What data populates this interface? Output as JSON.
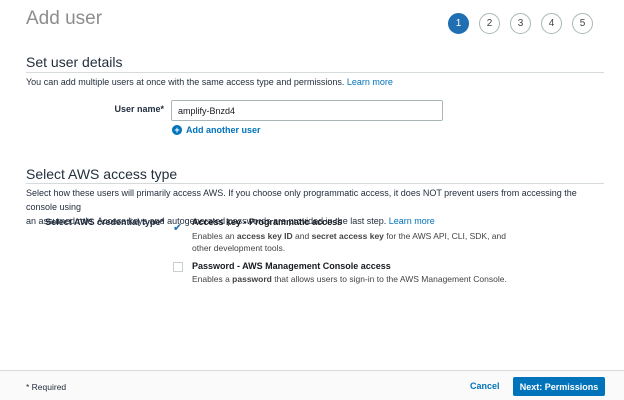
{
  "header": {
    "title": "Add user"
  },
  "steps": [
    {
      "label": "1",
      "active": true
    },
    {
      "label": "2",
      "active": false
    },
    {
      "label": "3",
      "active": false
    },
    {
      "label": "4",
      "active": false
    },
    {
      "label": "5",
      "active": false
    }
  ],
  "user_details": {
    "title": "Set user details",
    "help_text": "You can add multiple users at once with the same access type and permissions.",
    "learn_more": "Learn more",
    "user_name_label": "User name*",
    "user_name_value": "amplify-Bnzd4",
    "add_another_label": "Add another user",
    "plus_icon": "+"
  },
  "access_type": {
    "title": "Select AWS access type",
    "help_line1": "Select how these users will primarily access AWS. If you choose only programmatic access, it does NOT prevent users from accessing the console using",
    "help_line2": "an assumed role. Access keys and autogenerated passwords are provided in the last step.",
    "learn_more": "Learn more",
    "credential_label": "Select AWS credential type*",
    "options": [
      {
        "title": "Access key - Programmatic access",
        "checked": true,
        "desc_parts": [
          "Enables an ",
          "access key ID",
          " and ",
          "secret access key",
          " for the AWS API, CLI, SDK, and"
        ],
        "desc_line2": "other development tools."
      },
      {
        "title": "Password - AWS Management Console access",
        "checked": false,
        "desc_parts": [
          "Enables a ",
          "password",
          " that allows users to sign-in to the AWS Management Console."
        ]
      }
    ],
    "check_icon": "✔"
  },
  "footer": {
    "required_note": "* Required",
    "cancel_label": "Cancel",
    "next_label": "Next: Permissions"
  },
  "colors": {
    "accent": "#0073bb",
    "active_step": "#1f6fb2"
  }
}
